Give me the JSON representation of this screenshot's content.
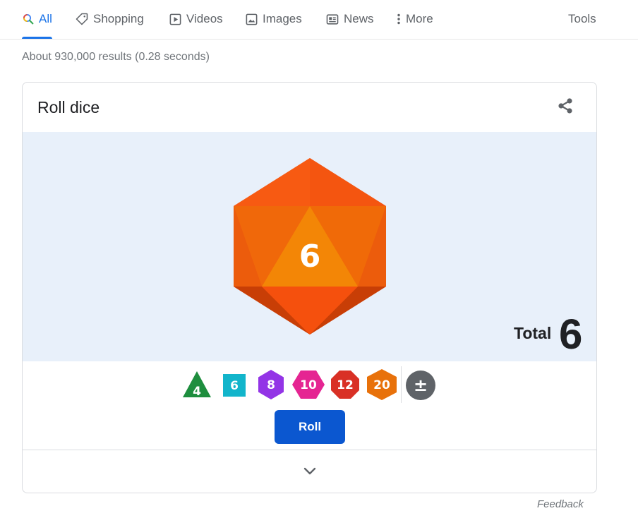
{
  "nav": {
    "tabs": [
      {
        "label": "All",
        "icon": "search-icon",
        "active": true
      },
      {
        "label": "Shopping",
        "icon": "tag-icon"
      },
      {
        "label": "Videos",
        "icon": "play-icon"
      },
      {
        "label": "Images",
        "icon": "image-icon"
      },
      {
        "label": "News",
        "icon": "news-icon"
      },
      {
        "label": "More",
        "icon": "more-vert-icon"
      }
    ],
    "tools_label": "Tools"
  },
  "result_stats": "About 930,000 results (0.28 seconds)",
  "card": {
    "title": "Roll dice",
    "share_icon": "share-icon",
    "die": {
      "sides": 20,
      "value": "6",
      "color": "#f05a13"
    },
    "total_label": "Total",
    "total_value": "6",
    "dice_options": [
      {
        "label": "4",
        "sides": 4,
        "color": "#1e8e3e"
      },
      {
        "label": "6",
        "sides": 6,
        "color": "#12b5cb"
      },
      {
        "label": "8",
        "sides": 8,
        "color": "#9334e6"
      },
      {
        "label": "10",
        "sides": 10,
        "color": "#e52592"
      },
      {
        "label": "12",
        "sides": 12,
        "color": "#d93025"
      },
      {
        "label": "20",
        "sides": 20,
        "color": "#e8710a"
      }
    ],
    "modifier_label": "±",
    "modifier_color": "#5f6368",
    "roll_label": "Roll",
    "roll_color": "#0b57d0",
    "expand_icon": "chevron-down-icon"
  },
  "feedback_label": "Feedback"
}
